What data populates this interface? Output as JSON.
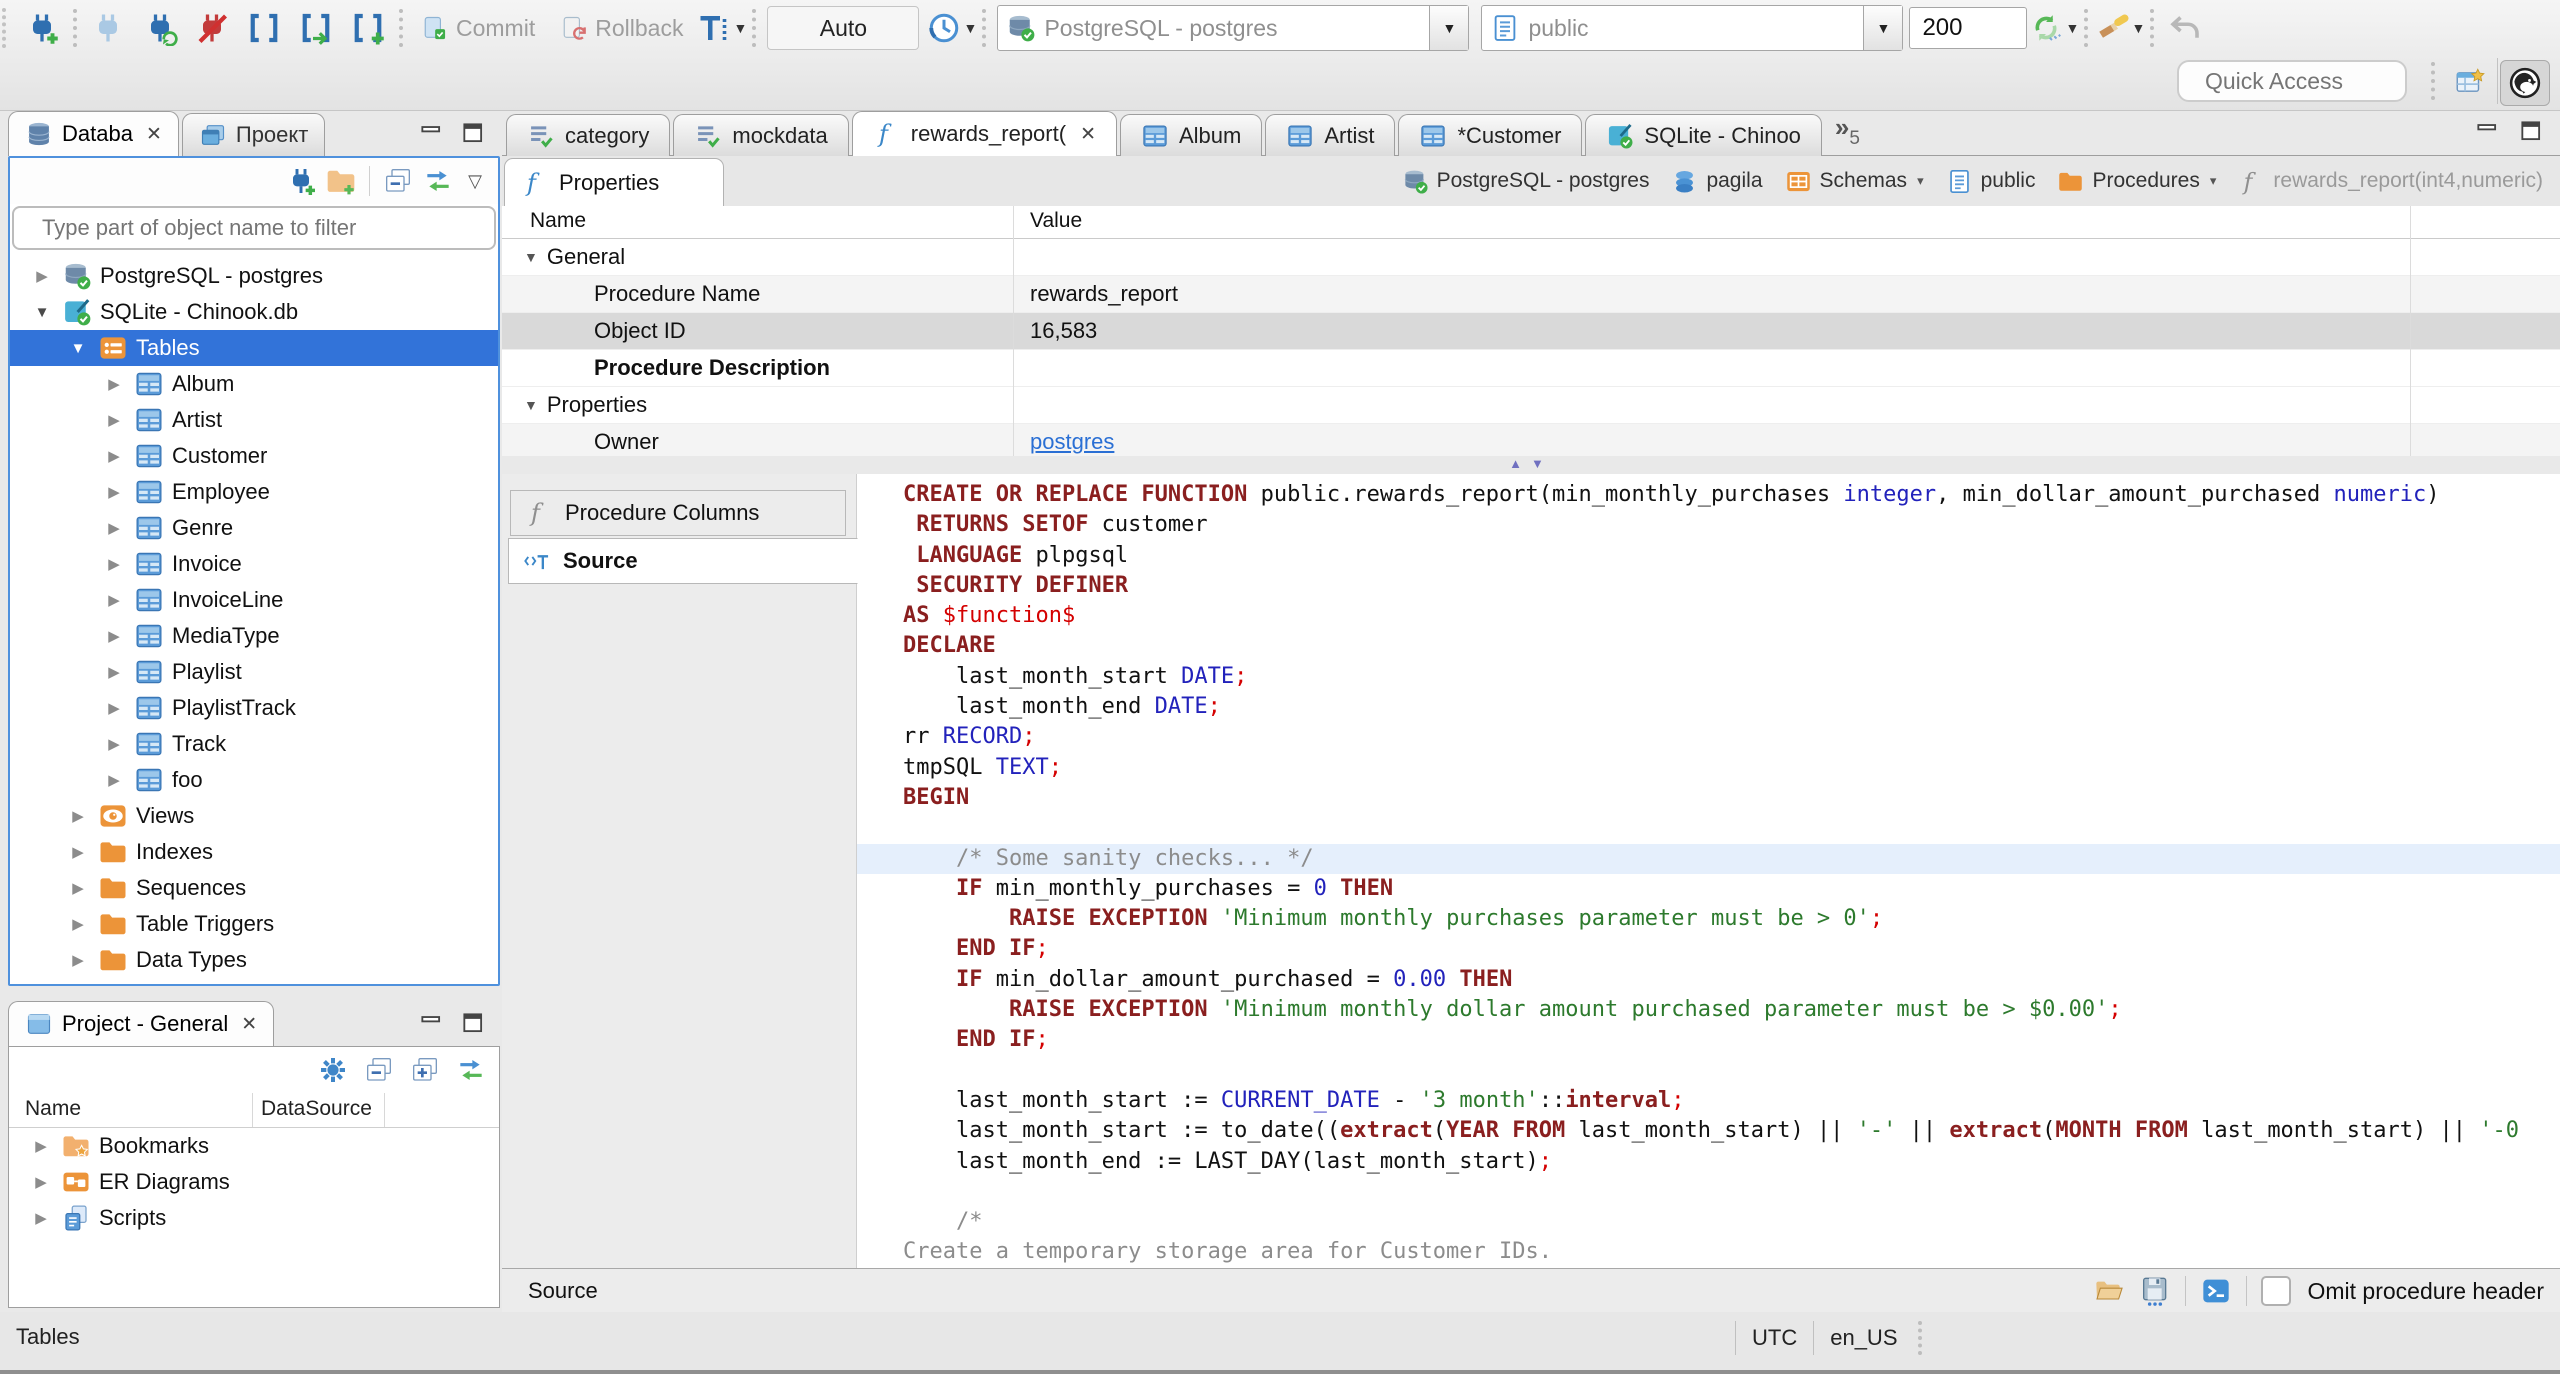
{
  "toolbar": {
    "commit": "Commit",
    "rollback": "Rollback",
    "tx_mode": "Auto",
    "connection": "PostgreSQL - postgres",
    "schema": "public",
    "fetch_size": "200",
    "quick_access": "Quick Access"
  },
  "statusbar": {
    "left": "Tables",
    "timezone": "UTC",
    "locale": "en_US"
  },
  "navigator": {
    "tab": "Databa",
    "tab_project": "Проект",
    "filter_placeholder": "Type part of object name to filter",
    "tree": [
      {
        "depth": 0,
        "arrow": "c",
        "icon": "db-postgres",
        "label": "PostgreSQL - postgres"
      },
      {
        "depth": 0,
        "arrow": "e",
        "icon": "db-sqlite",
        "label": "SQLite - Chinook.db"
      },
      {
        "depth": 1,
        "arrow": "e",
        "icon": "folder-tables",
        "label": "Tables",
        "selected": true
      },
      {
        "depth": 2,
        "arrow": "c",
        "icon": "table",
        "label": "Album"
      },
      {
        "depth": 2,
        "arrow": "c",
        "icon": "table",
        "label": "Artist"
      },
      {
        "depth": 2,
        "arrow": "c",
        "icon": "table",
        "label": "Customer"
      },
      {
        "depth": 2,
        "arrow": "c",
        "icon": "table",
        "label": "Employee"
      },
      {
        "depth": 2,
        "arrow": "c",
        "icon": "table",
        "label": "Genre"
      },
      {
        "depth": 2,
        "arrow": "c",
        "icon": "table",
        "label": "Invoice"
      },
      {
        "depth": 2,
        "arrow": "c",
        "icon": "table",
        "label": "InvoiceLine"
      },
      {
        "depth": 2,
        "arrow": "c",
        "icon": "table",
        "label": "MediaType"
      },
      {
        "depth": 2,
        "arrow": "c",
        "icon": "table",
        "label": "Playlist"
      },
      {
        "depth": 2,
        "arrow": "c",
        "icon": "table",
        "label": "PlaylistTrack"
      },
      {
        "depth": 2,
        "arrow": "c",
        "icon": "table",
        "label": "Track"
      },
      {
        "depth": 2,
        "arrow": "c",
        "icon": "table",
        "label": "foo"
      },
      {
        "depth": 1,
        "arrow": "c",
        "icon": "views",
        "label": "Views"
      },
      {
        "depth": 1,
        "arrow": "c",
        "icon": "folder",
        "label": "Indexes"
      },
      {
        "depth": 1,
        "arrow": "c",
        "icon": "folder",
        "label": "Sequences"
      },
      {
        "depth": 1,
        "arrow": "c",
        "icon": "folder",
        "label": "Table Triggers"
      },
      {
        "depth": 1,
        "arrow": "c",
        "icon": "folder",
        "label": "Data Types"
      }
    ]
  },
  "project_panel": {
    "title": "Project - General",
    "columns": [
      "Name",
      "DataSource"
    ],
    "items": [
      {
        "icon": "folder-bookmarks",
        "label": "Bookmarks"
      },
      {
        "icon": "er",
        "label": "ER Diagrams"
      },
      {
        "icon": "scripts",
        "label": "Scripts"
      }
    ]
  },
  "editor": {
    "tabs": [
      {
        "icon": "sql-script",
        "label": "category"
      },
      {
        "icon": "sql-script",
        "label": "mockdata"
      },
      {
        "icon": "function",
        "label": "rewards_report(",
        "active": true
      },
      {
        "icon": "table",
        "label": "Album"
      },
      {
        "icon": "table",
        "label": "Artist"
      },
      {
        "icon": "table",
        "label": "*Customer"
      },
      {
        "icon": "db-sqlite",
        "label": "SQLite - Chinoo"
      }
    ],
    "overflow_count": "5",
    "properties_tab": "Properties",
    "breadcrumb": [
      {
        "icon": "db-postgres",
        "label": "PostgreSQL - postgres"
      },
      {
        "icon": "db-blue",
        "label": "pagila"
      },
      {
        "icon": "schema",
        "label": "Schemas",
        "dd": true
      },
      {
        "icon": "page",
        "label": "public"
      },
      {
        "icon": "folder",
        "label": "Procedures",
        "dd": true
      },
      {
        "icon": "function-gray",
        "label": "rewards_report(int4,numeric)",
        "muted": true
      }
    ],
    "grid": {
      "columns": [
        "Name",
        "Value"
      ],
      "rows": [
        {
          "name": "General",
          "group": true
        },
        {
          "name": "Procedure Name",
          "value": "rewards_report",
          "shade": true
        },
        {
          "name": "Object ID",
          "value": "16,583",
          "selected": true
        },
        {
          "name": "Procedure Description",
          "bold": true
        },
        {
          "name": "Properties",
          "group": true
        },
        {
          "name": "Owner",
          "value": "postgres",
          "link": true,
          "shade": true
        }
      ]
    },
    "side_tabs": [
      {
        "icon": "function-gray",
        "label": "Procedure Columns"
      },
      {
        "icon": "source",
        "label": "Source",
        "active": true
      }
    ],
    "highlighted_line": 12,
    "source_lines": [
      [
        [
          "k",
          "CREATE OR REPLACE FUNCTION"
        ],
        [
          "w",
          " public.rewards_report(min_monthly_purchases "
        ],
        [
          "t",
          "integer"
        ],
        [
          "w",
          ", min_dollar_amount_purchased "
        ],
        [
          "t",
          "numeric"
        ],
        [
          "w",
          ")"
        ]
      ],
      [
        [
          "w",
          " "
        ],
        [
          "k",
          "RETURNS SETOF"
        ],
        [
          "w",
          " customer"
        ]
      ],
      [
        [
          "w",
          " "
        ],
        [
          "k",
          "LANGUAGE"
        ],
        [
          "w",
          " plpgsql"
        ]
      ],
      [
        [
          "w",
          " "
        ],
        [
          "k",
          "SECURITY DEFINER"
        ]
      ],
      [
        [
          "k",
          "AS"
        ],
        [
          "w",
          " "
        ],
        [
          "p",
          "$function$"
        ]
      ],
      [
        [
          "k",
          "DECLARE"
        ]
      ],
      [
        [
          "w",
          "    last_month_start "
        ],
        [
          "t",
          "DATE"
        ],
        [
          "p",
          ";"
        ]
      ],
      [
        [
          "w",
          "    last_month_end "
        ],
        [
          "t",
          "DATE"
        ],
        [
          "p",
          ";"
        ]
      ],
      [
        [
          "w",
          "rr "
        ],
        [
          "t",
          "RECORD"
        ],
        [
          "p",
          ";"
        ]
      ],
      [
        [
          "w",
          "tmpSQL "
        ],
        [
          "t",
          "TEXT"
        ],
        [
          "p",
          ";"
        ]
      ],
      [
        [
          "k",
          "BEGIN"
        ]
      ],
      [],
      [
        [
          "c",
          "    /* Some sanity checks... */"
        ]
      ],
      [
        [
          "w",
          "    "
        ],
        [
          "k",
          "IF"
        ],
        [
          "w",
          " min_monthly_purchases = "
        ],
        [
          "n",
          "0"
        ],
        [
          "w",
          " "
        ],
        [
          "k",
          "THEN"
        ]
      ],
      [
        [
          "w",
          "        "
        ],
        [
          "k",
          "RAISE EXCEPTION"
        ],
        [
          "w",
          " "
        ],
        [
          "s",
          "'Minimum monthly purchases parameter must be > 0'"
        ],
        [
          "p",
          ";"
        ]
      ],
      [
        [
          "w",
          "    "
        ],
        [
          "k",
          "END IF"
        ],
        [
          "p",
          ";"
        ]
      ],
      [
        [
          "w",
          "    "
        ],
        [
          "k",
          "IF"
        ],
        [
          "w",
          " min_dollar_amount_purchased = "
        ],
        [
          "n",
          "0.00"
        ],
        [
          "w",
          " "
        ],
        [
          "k",
          "THEN"
        ]
      ],
      [
        [
          "w",
          "        "
        ],
        [
          "k",
          "RAISE EXCEPTION"
        ],
        [
          "w",
          " "
        ],
        [
          "s",
          "'Minimum monthly dollar amount purchased parameter must be > $0.00'"
        ],
        [
          "p",
          ";"
        ]
      ],
      [
        [
          "w",
          "    "
        ],
        [
          "k",
          "END IF"
        ],
        [
          "p",
          ";"
        ]
      ],
      [],
      [
        [
          "w",
          "    last_month_start := "
        ],
        [
          "t",
          "CURRENT_DATE"
        ],
        [
          "w",
          " - "
        ],
        [
          "s",
          "'3 month'"
        ],
        [
          "w",
          "::"
        ],
        [
          "k",
          "interval"
        ],
        [
          "p",
          ";"
        ]
      ],
      [
        [
          "w",
          "    last_month_start := to_date(("
        ],
        [
          "k",
          "extract"
        ],
        [
          "w",
          "("
        ],
        [
          "k",
          "YEAR FROM"
        ],
        [
          "w",
          " last_month_start) || "
        ],
        [
          "s",
          "'-'"
        ],
        [
          "w",
          " || "
        ],
        [
          "k",
          "extract"
        ],
        [
          "w",
          "("
        ],
        [
          "k",
          "MONTH FROM"
        ],
        [
          "w",
          " last_month_start) || "
        ],
        [
          "s",
          "'-0"
        ]
      ],
      [
        [
          "w",
          "    last_month_end := LAST_DAY(last_month_start)"
        ],
        [
          "p",
          ";"
        ]
      ],
      [],
      [
        [
          "c",
          "    /*"
        ]
      ],
      [
        [
          "c",
          "Create a temporary storage area for Customer IDs."
        ]
      ],
      [
        [
          "c",
          "*/"
        ]
      ]
    ],
    "bottom_bar": {
      "label": "Source",
      "omit_checkbox": "Omit procedure header"
    }
  }
}
